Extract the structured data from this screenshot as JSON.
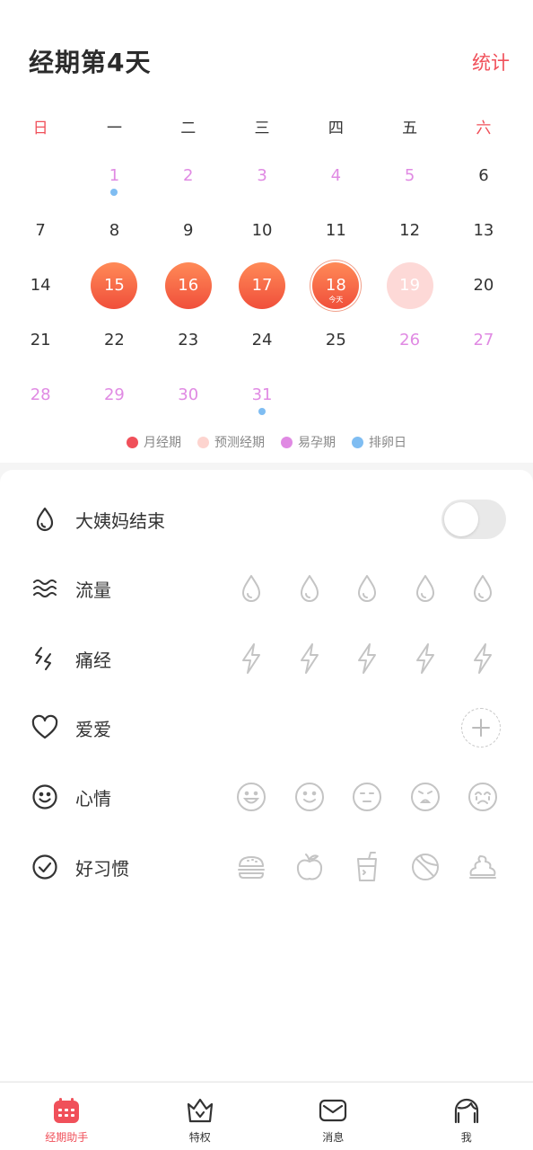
{
  "header": {
    "title": "经期第4天",
    "stats_label": "统计"
  },
  "weekdays": [
    "日",
    "一",
    "二",
    "三",
    "四",
    "五",
    "六"
  ],
  "calendar": {
    "rows": [
      [
        {
          "d": ""
        },
        {
          "d": "1",
          "t": "fert",
          "dot": true
        },
        {
          "d": "2",
          "t": "fert"
        },
        {
          "d": "3",
          "t": "fert"
        },
        {
          "d": "4",
          "t": "fert"
        },
        {
          "d": "5",
          "t": "fert"
        },
        {
          "d": "6"
        }
      ],
      [
        {
          "d": "7"
        },
        {
          "d": "8"
        },
        {
          "d": "9"
        },
        {
          "d": "10"
        },
        {
          "d": "11"
        },
        {
          "d": "12"
        },
        {
          "d": "13"
        }
      ],
      [
        {
          "d": "14"
        },
        {
          "d": "15",
          "t": "period"
        },
        {
          "d": "16",
          "t": "period"
        },
        {
          "d": "17",
          "t": "period"
        },
        {
          "d": "18",
          "t": "today"
        },
        {
          "d": "19",
          "t": "pred"
        },
        {
          "d": "20"
        }
      ],
      [
        {
          "d": "21"
        },
        {
          "d": "22"
        },
        {
          "d": "23"
        },
        {
          "d": "24"
        },
        {
          "d": "25"
        },
        {
          "d": "26",
          "t": "fert"
        },
        {
          "d": "27",
          "t": "fert"
        }
      ],
      [
        {
          "d": "28",
          "t": "fert"
        },
        {
          "d": "29",
          "t": "fert"
        },
        {
          "d": "30",
          "t": "fert"
        },
        {
          "d": "31",
          "t": "fert",
          "dot": true
        },
        {
          "d": ""
        },
        {
          "d": ""
        },
        {
          "d": ""
        }
      ]
    ],
    "today_label": "今天"
  },
  "legend": [
    {
      "label": "月经期",
      "color": "#f0505a"
    },
    {
      "label": "预测经期",
      "color": "#fdd4cf"
    },
    {
      "label": "易孕期",
      "color": "#e08ae3"
    },
    {
      "label": "排卵日",
      "color": "#7fbdf2"
    }
  ],
  "records": {
    "period_end": "大姨妈结束",
    "flow": "流量",
    "cramps": "痛经",
    "love": "爱爱",
    "mood": "心情",
    "habits": "好习惯"
  },
  "tabs": [
    {
      "label": "经期助手",
      "active": true
    },
    {
      "label": "特权"
    },
    {
      "label": "消息"
    },
    {
      "label": "我"
    }
  ],
  "colors": {
    "accent": "#f0505a",
    "fertile": "#e08ae3",
    "ovulation": "#7fbdf2",
    "predicted": "#fdd9d7"
  }
}
